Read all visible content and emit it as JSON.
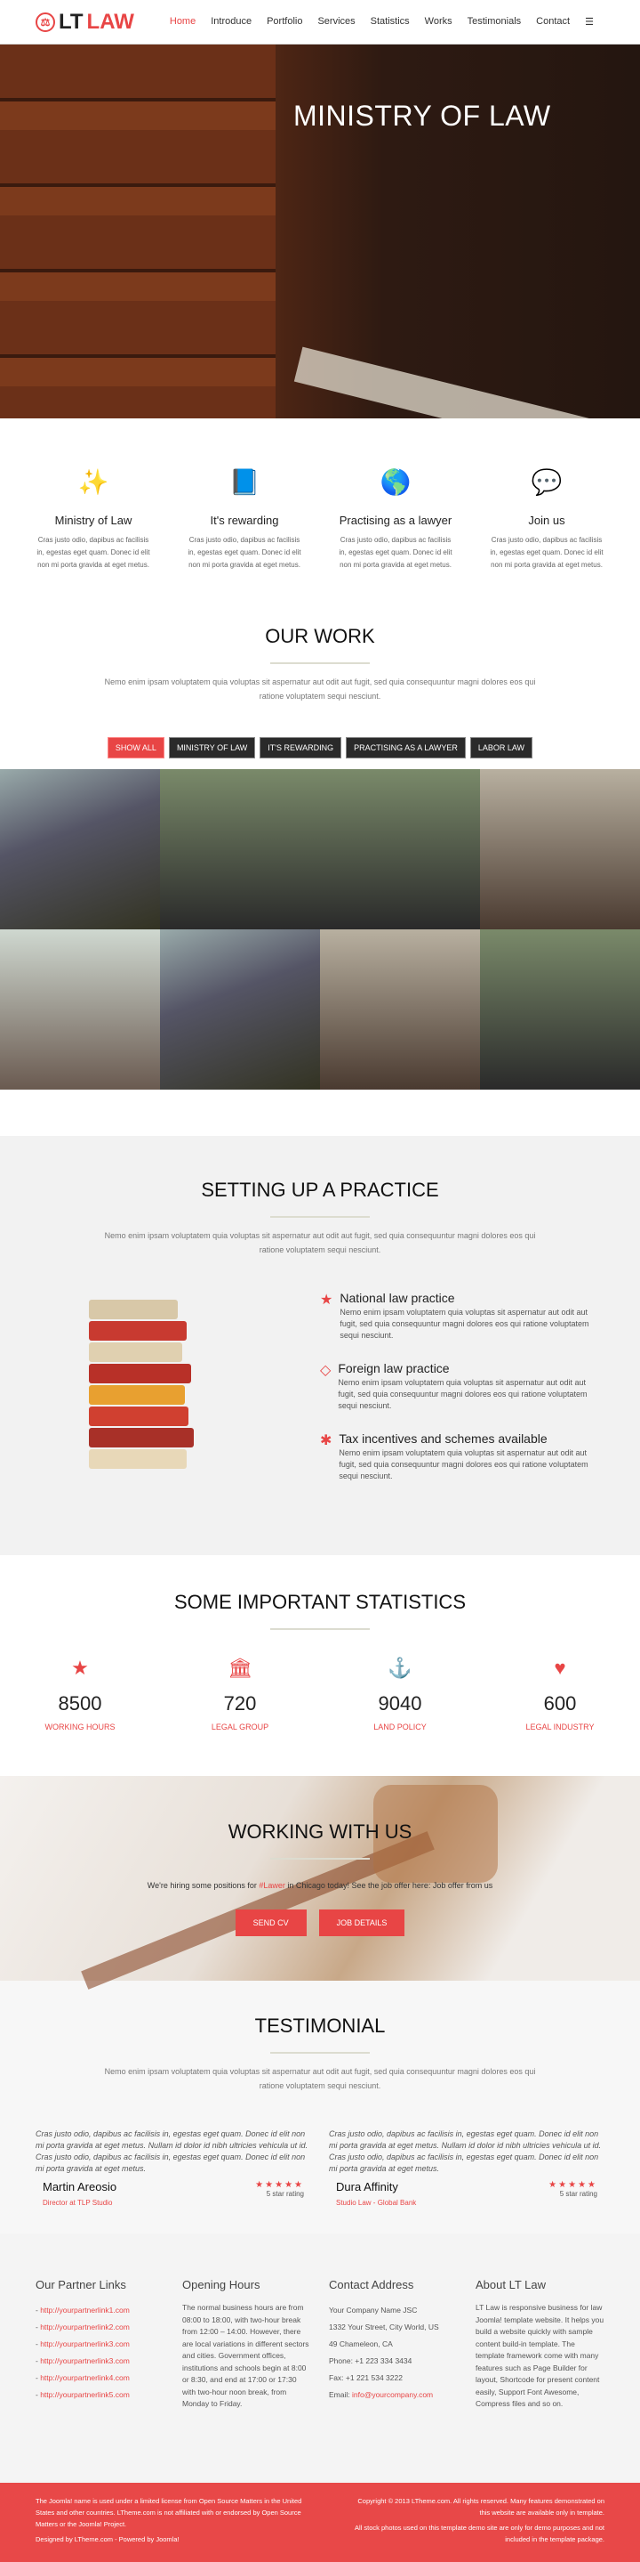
{
  "nav": {
    "logo_lt": "LT",
    "logo_law": "LAW",
    "items": [
      "Home",
      "Introduce",
      "Portfolio",
      "Services",
      "Statistics",
      "Works",
      "Testimonials",
      "Contact"
    ],
    "active": "Home"
  },
  "hero": {
    "title": "MINISTRY OF LAW"
  },
  "features": [
    {
      "icon": "magic-wand-icon",
      "title": "Ministry of Law",
      "text": "Cras justo odio, dapibus ac facilisis in, egestas eget quam. Donec id elit non mi porta gravida at eget metus."
    },
    {
      "icon": "book-icon",
      "title": "It's rewarding",
      "text": "Cras justo odio, dapibus ac facilisis in, egestas eget quam. Donec id elit non mi porta gravida at eget metus."
    },
    {
      "icon": "globe-icon",
      "title": "Practising as a lawyer",
      "text": "Cras justo odio, dapibus ac facilisis in, egestas eget quam. Donec id elit non mi porta gravida at eget metus."
    },
    {
      "icon": "comments-icon",
      "title": "Join us",
      "text": "Cras justo odio, dapibus ac facilisis in, egestas eget quam. Donec id elit non mi porta gravida at eget metus."
    }
  ],
  "work": {
    "title": "OUR WORK",
    "desc": "Nemo enim ipsam voluptatem quia voluptas sit aspernatur aut odit aut fugit, sed quia consequuntur magni dolores eos qui ratione voluptatem sequi nesciunt.",
    "filters": [
      "SHOW ALL",
      "MINISTRY OF LAW",
      "IT'S REWARDING",
      "PRACTISING AS A LAWYER",
      "LABOR LAW"
    ]
  },
  "practice": {
    "title": "SETTING UP A PRACTICE",
    "desc": "Nemo enim ipsam voluptatem quia voluptas sit aspernatur aut odit aut fugit, sed quia consequuntur magni dolores eos qui ratione voluptatem sequi nesciunt.",
    "items": [
      {
        "icon": "star-icon",
        "title": "National law practice",
        "text": "Nemo enim ipsam voluptatem quia voluptas sit aspernatur aut odit aut fugit, sed quia consequuntur magni dolores eos qui ratione voluptatem sequi nesciunt."
      },
      {
        "icon": "diamond-icon",
        "title": "Foreign law practice",
        "text": "Nemo enim ipsam voluptatem quia voluptas sit aspernatur aut odit aut fugit, sed quia consequuntur magni dolores eos qui ratione voluptatem sequi nesciunt."
      },
      {
        "icon": "empire-icon",
        "title": "Tax incentives and schemes available",
        "text": "Nemo enim ipsam voluptatem quia voluptas sit aspernatur aut odit aut fugit, sed quia consequuntur magni dolores eos qui ratione voluptatem sequi nesciunt."
      }
    ]
  },
  "stats": {
    "title": "SOME IMPORTANT STATISTICS",
    "items": [
      {
        "icon": "star-icon",
        "value": "8500",
        "label": "WORKING HOURS"
      },
      {
        "icon": "bank-icon",
        "value": "720",
        "label": "LEGAL GROUP"
      },
      {
        "icon": "anchor-icon",
        "value": "9040",
        "label": "LAND POLICY"
      },
      {
        "icon": "heart-icon",
        "value": "600",
        "label": "LEGAL INDUSTRY"
      }
    ]
  },
  "working": {
    "title": "WORKING WITH US",
    "text_before": "We're hiring some positions for ",
    "tag": "#Lawer",
    "text_after": " in Chicago today! See the job offer here: ",
    "link": "Job offer from us",
    "send_cv": "SEND CV",
    "job_details": "JOB DETAILS"
  },
  "testimonial": {
    "title": "TESTIMONIAL",
    "desc": "Nemo enim ipsam voluptatem quia voluptas sit aspernatur aut odit aut fugit, sed quia consequuntur magni dolores eos qui ratione voluptatem sequi nesciunt.",
    "items": [
      {
        "quote": "Cras justo odio, dapibus ac facilisis in, egestas eget quam. Donec id elit non mi porta gravida at eget metus. Nullam id dolor id nibh ultricies vehicula ut id. Cras justo odio, dapibus ac facilisis in, egestas eget quam. Donec id elit non mi porta gravida at eget metus.",
        "name": "Martin Areosio",
        "role": "Director at TLP Studio",
        "stars": "★★★★★",
        "rating": "5 star rating"
      },
      {
        "quote": "Cras justo odio, dapibus ac facilisis in, egestas eget quam. Donec id elit non mi porta gravida at eget metus. Nullam id dolor id nibh ultricies vehicula ut id. Cras justo odio, dapibus ac facilisis in, egestas eget quam. Donec id elit non mi porta gravida at eget metus.",
        "name": "Dura Affinity",
        "role": "Studio Law - Global Bank",
        "stars": "★★★★★",
        "rating": "5 star rating"
      }
    ]
  },
  "footer": {
    "partners": {
      "title": "Our Partner Links",
      "links": [
        "http://yourpartnerlink1.com",
        "http://yourpartnerlink2.com",
        "http://yourpartnerlink3.com",
        "http://yourpartnerlink3.com",
        "http://yourpartnerlink4.com",
        "http://yourpartnerlink5.com"
      ]
    },
    "hours": {
      "title": "Opening Hours",
      "text": "The normal business hours are from 08:00 to 18:00, with two-hour break from 12:00 – 14:00. However, there are local variations in different sectors and cities. Government offices, institutions and schools begin at 8:00 or 8:30, and end at 17:00 or 17:30 with two-hour noon break, from Monday to Friday."
    },
    "contact": {
      "title": "Contact Address",
      "company": "Your Company Name JSC",
      "street": "1332 Your Street, City World, US",
      "city": "49 Chameleon, CA",
      "phone": "Phone: +1 223 334 3434",
      "fax": "Fax: +1 221 534 3222",
      "email_label": "Email: ",
      "email": "info@yourcompany.com"
    },
    "about": {
      "title": "About LT Law",
      "text": "LT Law is responsive business for law Joomla! template website. It helps you build a website quickly with sample content build-in template. The template framework come with many features such as Page Builder for layout, Shortcode for present content easily, Support Font Awesome, Compress files and so on."
    }
  },
  "bottom": {
    "left1": "The Joomla! name is used under a limited license from Open Source Matters in the United States and other countries. LTheme.com is not affiliated with or endorsed by Open Source Matters or the Joomla! Project.",
    "left2": "Designed by LTheme.com - Powered by Joomla!",
    "right1": "Copyright © 2013 LTheme.com. All rights reserved. Many features demonstrated on this website are available only in template.",
    "right2": "All stock photos used on this template demo site are only for demo purposes and not included in the template package."
  },
  "colors": {
    "accent": "#e84545",
    "dark": "#2a2a2a",
    "icon_gray": "#8fa2b5"
  }
}
